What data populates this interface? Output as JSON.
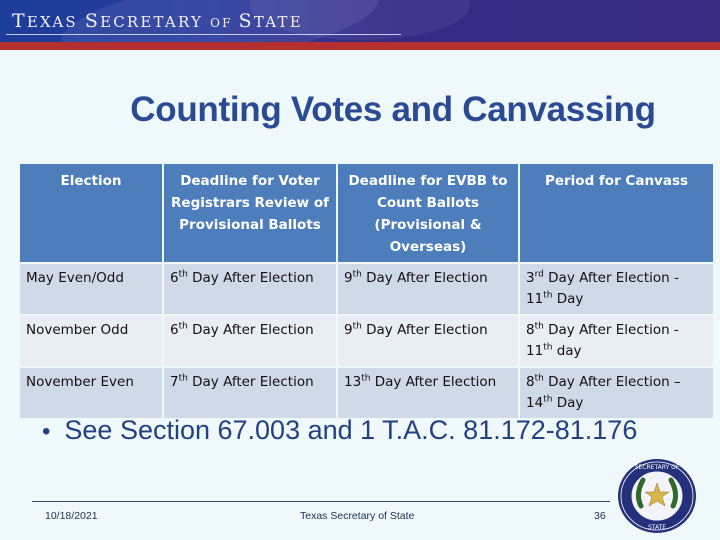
{
  "header": {
    "brand_caps": [
      "T",
      "S",
      "S"
    ],
    "brand_text": "Texas Secretary of State",
    "brand_parts": [
      "T",
      "EXAS ",
      "S",
      "ECRETARY ",
      "OF ",
      "S",
      "TATE"
    ],
    "colors": {
      "banner": "#2a3a9c",
      "stripe": "#b43030"
    }
  },
  "slide": {
    "title": "Counting Votes and Canvassing",
    "title_color": "#2a4b93"
  },
  "table": {
    "header_color": "#4d7ebb",
    "columns": [
      "Election",
      "Deadline for Voter Registrars Review of Provisional Ballots",
      "Deadline for EVBB to Count Ballots (Provisional & Overseas)",
      "Period for Canvass"
    ],
    "rows": [
      {
        "election": "May Even/Odd",
        "registrar": {
          "num": "6",
          "sup": "th",
          "rest": " Day After Election"
        },
        "evbb": {
          "num": "9",
          "sup": "th",
          "rest": " Day After Election"
        },
        "canvass": {
          "num": "3",
          "sup": "rd",
          "mid": " Day After Election - ",
          "num2": "11",
          "sup2": "th",
          "rest": " Day"
        }
      },
      {
        "election": "November Odd",
        "registrar": {
          "num": "6",
          "sup": "th",
          "rest": " Day After Election"
        },
        "evbb": {
          "num": "9",
          "sup": "th",
          "rest": " Day After Election"
        },
        "canvass": {
          "num": "8",
          "sup": "th",
          "mid": " Day After Election - ",
          "num2": "11",
          "sup2": "th",
          "rest": " day"
        }
      },
      {
        "election": "November Even",
        "registrar": {
          "num": "7",
          "sup": "th",
          "rest": " Day After Election"
        },
        "evbb": {
          "num": "13",
          "sup": "th",
          "rest": " Day After Election"
        },
        "canvass": {
          "num": "8",
          "sup": "th",
          "mid": " Day After Election – ",
          "num2": "14",
          "sup2": "th",
          "rest": " Day"
        }
      }
    ]
  },
  "bullet": {
    "symbol": "•",
    "text": "See Section 67.003 and 1 T.A.C. 81.172-81.176"
  },
  "footer": {
    "date": "10/18/2021",
    "center": "Texas Secretary of State",
    "page": "36",
    "seal_icon": "texas-secretary-of-state-seal"
  }
}
